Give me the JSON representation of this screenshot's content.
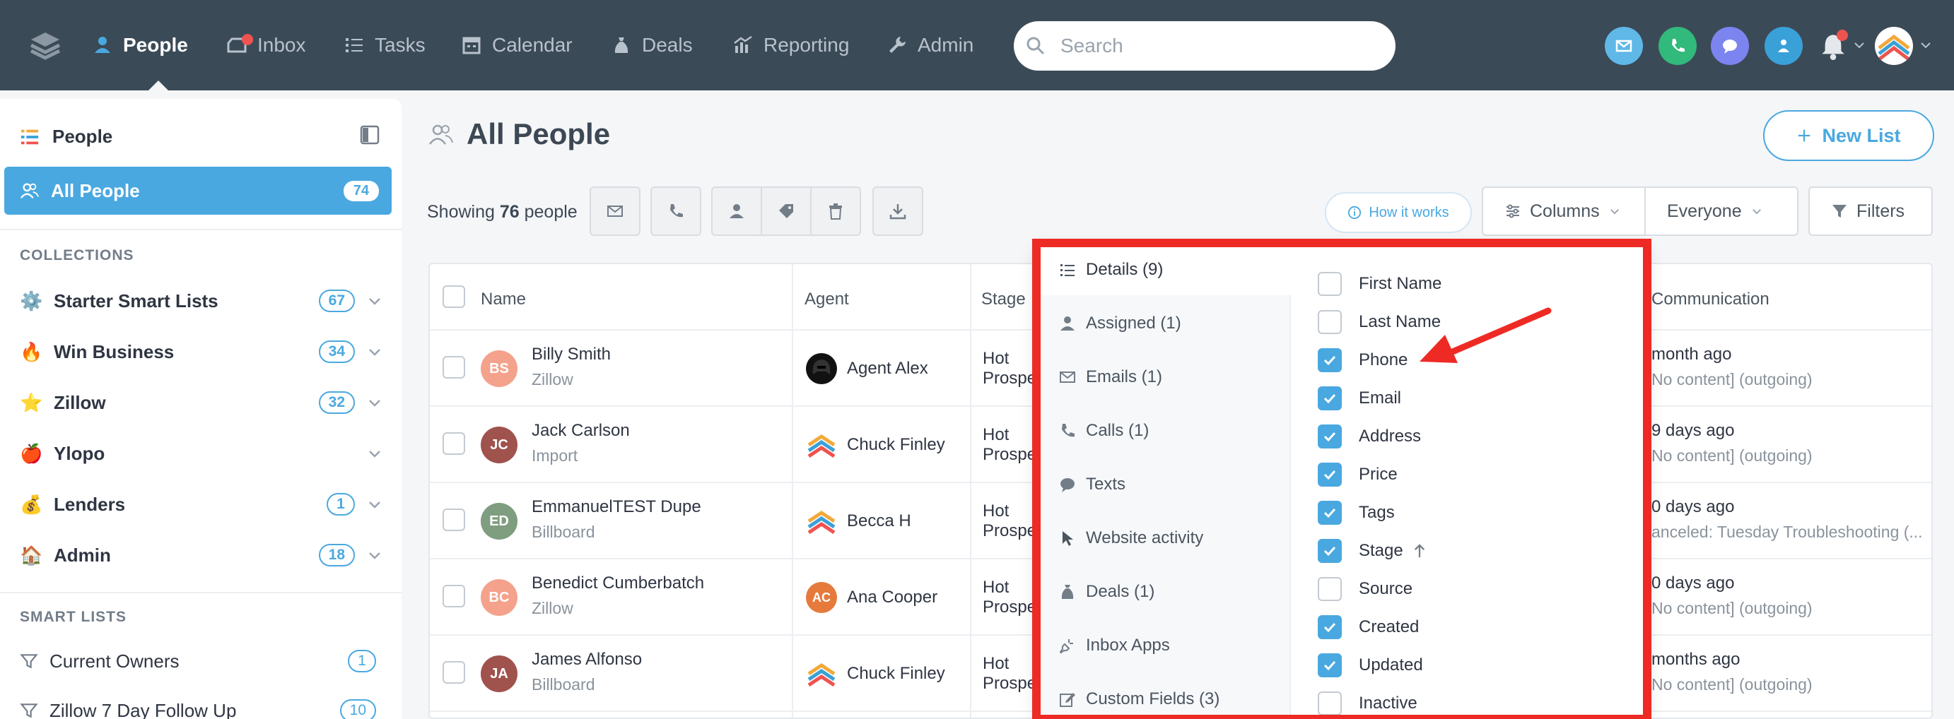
{
  "nav": {
    "items": [
      {
        "label": "People",
        "icon": "person-icon",
        "active": true
      },
      {
        "label": "Inbox",
        "icon": "inbox-icon",
        "active": false
      },
      {
        "label": "Tasks",
        "icon": "tasks-icon",
        "active": false
      },
      {
        "label": "Calendar",
        "icon": "calendar-icon",
        "active": false
      },
      {
        "label": "Deals",
        "icon": "money-bag-icon",
        "active": false
      },
      {
        "label": "Reporting",
        "icon": "chart-icon",
        "active": false
      },
      {
        "label": "Admin",
        "icon": "wrench-icon",
        "active": false
      }
    ],
    "search_placeholder": "Search"
  },
  "sidebar": {
    "title": "People",
    "active": {
      "label": "All People",
      "count": "74"
    },
    "collections_heading": "COLLECTIONS",
    "collections": [
      {
        "emoji": "⚙️",
        "label": "Starter Smart Lists",
        "count": "67"
      },
      {
        "emoji": "🔥",
        "label": "Win Business",
        "count": "34"
      },
      {
        "emoji": "⭐",
        "label": "Zillow",
        "count": "32"
      },
      {
        "emoji": "🍎",
        "label": "Ylopo",
        "count": ""
      },
      {
        "emoji": "💰",
        "label": "Lenders",
        "count": "1"
      },
      {
        "emoji": "🏠",
        "label": "Admin",
        "count": "18"
      }
    ],
    "smart_heading": "SMART LISTS",
    "smart_lists": [
      {
        "label": "Current Owners",
        "count": "1"
      },
      {
        "label": "Zillow 7 Day Follow Up",
        "count": "10"
      }
    ]
  },
  "main": {
    "title": "All People",
    "new_list": "New List",
    "showing_prefix": "Showing",
    "showing_count": "76",
    "showing_suffix": "people",
    "how_it_works": "How it works",
    "columns_label": "Columns",
    "everyone_label": "Everyone",
    "filters_label": "Filters"
  },
  "table": {
    "headers": {
      "name": "Name",
      "agent": "Agent",
      "stage": "Stage",
      "communication": "Communication"
    },
    "rows": [
      {
        "initials": "BS",
        "avatar_color": "#f4a28c",
        "name": "Billy Smith",
        "source": "Zillow",
        "agent": "Agent Alex",
        "agent_icon": "helmet",
        "stage1": "Hot",
        "stage2": "Prospe",
        "comm1": "month ago",
        "comm2": "No content] (outgoing)"
      },
      {
        "initials": "JC",
        "avatar_color": "#a0524d",
        "name": "Jack Carlson",
        "source": "Import",
        "agent": "Chuck Finley",
        "agent_icon": "logo",
        "stage1": "Hot",
        "stage2": "Prospe",
        "comm1": "9 days ago",
        "comm2": "No content] (outgoing)"
      },
      {
        "initials": "ED",
        "avatar_color": "#7f9d7f",
        "name": "EmmanuelTEST Dupe",
        "source": "Billboard",
        "agent": "Becca H",
        "agent_icon": "logo",
        "stage1": "Hot",
        "stage2": "Prospe",
        "comm1": "0 days ago",
        "comm2": "anceled: Tuesday Troubleshooting (..."
      },
      {
        "initials": "BC",
        "avatar_color": "#f4a28c",
        "name": "Benedict Cumberbatch",
        "source": "Zillow",
        "agent": "Ana Cooper",
        "agent_icon": "AC",
        "stage1": "Hot",
        "stage2": "Prospe",
        "comm1": "0 days ago",
        "comm2": "No content] (outgoing)"
      },
      {
        "initials": "JA",
        "avatar_color": "#a0524d",
        "name": "James Alfonso",
        "source": "Billboard",
        "agent": "Chuck Finley",
        "agent_icon": "logo",
        "stage1": "Hot",
        "stage2": "Prospe",
        "comm1": "months ago",
        "comm2": "No content] (outgoing)"
      }
    ]
  },
  "popup": {
    "categories": [
      {
        "label": "Details (9)",
        "icon": "list-icon",
        "active": true
      },
      {
        "label": "Assigned (1)",
        "icon": "person-icon",
        "active": false
      },
      {
        "label": "Emails (1)",
        "icon": "envelope-icon",
        "active": false
      },
      {
        "label": "Calls (1)",
        "icon": "phone-icon",
        "active": false
      },
      {
        "label": "Texts",
        "icon": "chat-bubble-icon",
        "active": false
      },
      {
        "label": "Website activity",
        "icon": "cursor-icon",
        "active": false
      },
      {
        "label": "Deals (1)",
        "icon": "money-bag-icon",
        "active": false
      },
      {
        "label": "Inbox Apps",
        "icon": "plug-icon",
        "active": false
      },
      {
        "label": "Custom Fields (3)",
        "icon": "edit-icon",
        "active": false
      }
    ],
    "options": [
      {
        "label": "First Name",
        "checked": false
      },
      {
        "label": "Last Name",
        "checked": false
      },
      {
        "label": "Phone",
        "checked": true
      },
      {
        "label": "Email",
        "checked": true
      },
      {
        "label": "Address",
        "checked": true
      },
      {
        "label": "Price",
        "checked": true
      },
      {
        "label": "Tags",
        "checked": true
      },
      {
        "label": "Stage",
        "checked": true
      },
      {
        "label": "Source",
        "checked": false
      },
      {
        "label": "Created",
        "checked": true
      },
      {
        "label": "Updated",
        "checked": true
      },
      {
        "label": "Inactive",
        "checked": false
      }
    ]
  },
  "colors": {
    "accent": "#4aa8e0",
    "nav_bg": "#3b4a57",
    "highlight": "#ee2a24"
  }
}
